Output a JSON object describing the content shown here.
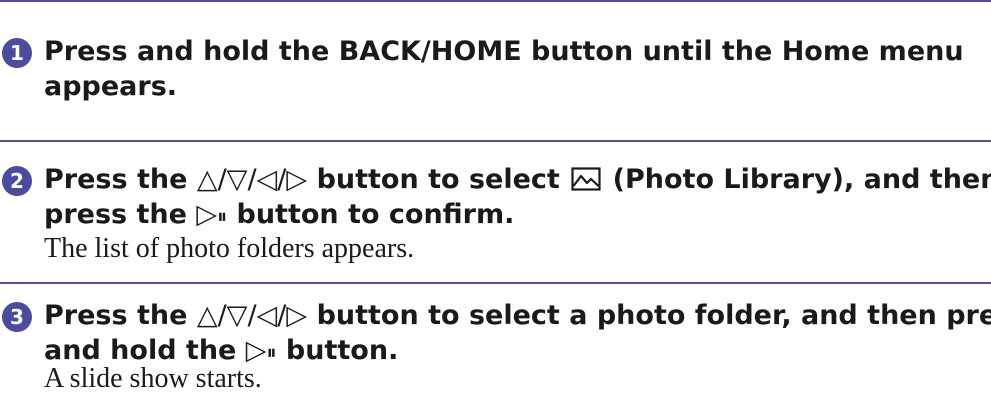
{
  "steps": [
    {
      "number": "1",
      "title_line1": "Press and hold the BACK/HOME button until the Home menu",
      "title_line2": "appears.",
      "note": ""
    },
    {
      "number": "2",
      "title_line1_a": "Press the ",
      "arrows": "△/▽/◁/▷",
      "title_line1_b": " button to select ",
      "photo_icon": "photo-library-icon",
      "title_line1_c": " (Photo Library), and then",
      "title_line2_a": "press the ",
      "play_pause": "▷",
      "title_line2_b": " button to confirm.",
      "note": "The list of photo folders appears."
    },
    {
      "number": "3",
      "title_line1_a": "Press the ",
      "arrows": "△/▽/◁/▷",
      "title_line1_b": " button to select a photo folder, and then press",
      "title_line2_a": "and hold the ",
      "play_pause": "▷",
      "title_line2_b": " button.",
      "note": "A slide show starts."
    }
  ],
  "colors": {
    "rule": "#4e4e9c",
    "badge": "#4b4ba0",
    "text": "#1a1a1a"
  }
}
